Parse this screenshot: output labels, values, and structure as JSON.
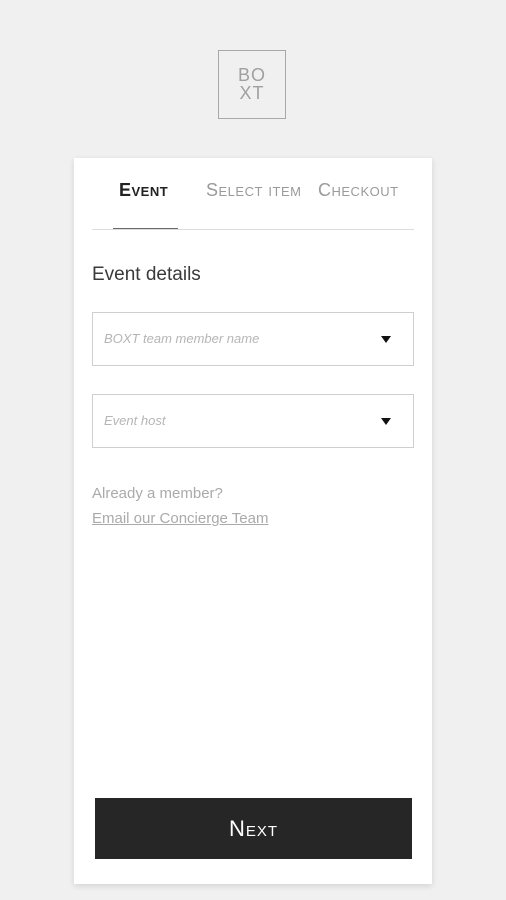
{
  "brand": {
    "logo_line1": "BO",
    "logo_line2": "XT"
  },
  "tabs": [
    {
      "label": "Event",
      "active": true
    },
    {
      "label": "Select item",
      "active": false
    },
    {
      "label": "Checkout",
      "active": false
    }
  ],
  "form": {
    "section_title": "Event details",
    "team_member_placeholder": "BOXT team member name",
    "event_host_placeholder": "Event host"
  },
  "member": {
    "prompt": "Already a member?",
    "link": "Email our Concierge Team"
  },
  "actions": {
    "next_label": "Next"
  },
  "colors": {
    "background": "#f0f0f0",
    "card": "#ffffff",
    "button": "#262626",
    "muted_text": "#aaaaaa"
  }
}
